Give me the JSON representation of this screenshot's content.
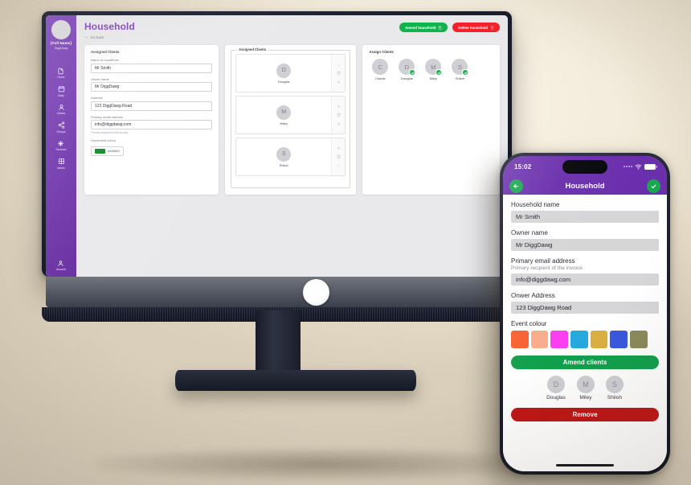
{
  "desktop": {
    "sidebar": {
      "user_name": "[Full Name]",
      "user_org": "DiggDawg",
      "items": [
        {
          "label": "Home",
          "icon": "file-icon"
        },
        {
          "label": "Diary",
          "icon": "calendar-icon"
        },
        {
          "label": "Clients",
          "icon": "person-icon"
        },
        {
          "label": "Groups",
          "icon": "share-nodes-icon"
        },
        {
          "label": "Services",
          "icon": "tools-icon"
        },
        {
          "label": "Admin",
          "icon": "grid-icon"
        }
      ],
      "account": {
        "label": "Account",
        "icon": "user-icon"
      }
    },
    "header": {
      "title": "Household",
      "go_back": "Go back",
      "amend_button": "Amend household",
      "delete_button": "Delete household"
    },
    "details_card": {
      "heading": "Assigned Clients",
      "fields": [
        {
          "label": "Name of household",
          "value": "Mr Smith"
        },
        {
          "label": "Owner name",
          "value": "Mr DiggDawg"
        },
        {
          "label": "Address",
          "value": "123 DiggDawg Road"
        },
        {
          "label": "Primary email address",
          "value": "info@diggdawg.com",
          "hint": "Primary recipient of the invoice"
        }
      ],
      "colour_label": "Household colour",
      "colour_hex": "#0A8620"
    },
    "assigned_card": {
      "legend": "Assigned Clients",
      "rows": [
        {
          "initial": "D",
          "name": "Douglas",
          "up_enabled": false,
          "down_enabled": true
        },
        {
          "initial": "M",
          "name": "Miley",
          "up_enabled": true,
          "down_enabled": true
        },
        {
          "initial": "S",
          "name": "Shiloh",
          "up_enabled": true,
          "down_enabled": false
        }
      ]
    },
    "assign_card": {
      "heading": "Assign Clients",
      "clients": [
        {
          "initial": "C",
          "name": "Charlie",
          "assigned": false
        },
        {
          "initial": "D",
          "name": "Douglas",
          "assigned": true
        },
        {
          "initial": "M",
          "name": "Miley",
          "assigned": true
        },
        {
          "initial": "S",
          "name": "Shiloh",
          "assigned": true
        }
      ]
    }
  },
  "phone": {
    "status": {
      "time": "15:02"
    },
    "app_bar": {
      "title": "Household",
      "back_icon": "arrow-left-icon",
      "confirm_icon": "check-icon"
    },
    "fields": [
      {
        "label": "Household name",
        "value": "Mr Smith"
      },
      {
        "label": "Owner name",
        "value": "Mr DiggDawg"
      },
      {
        "label": "Primary email address",
        "sub": "Primary recipient of the invoice",
        "value": "info@diggdawg.com"
      },
      {
        "label": "Onwer Address",
        "value": "123 DiggDawg Road"
      }
    ],
    "colour_label": "Event colour",
    "colours": [
      "#f96233",
      "#faac8c",
      "#fa3ef0",
      "#26a9df",
      "#dcaf42",
      "#3a58dd",
      "#8b8a5c"
    ],
    "amend_button": "Amend clients",
    "avatars": [
      {
        "initial": "D",
        "name": "Douglas"
      },
      {
        "initial": "M",
        "name": "Miley"
      },
      {
        "initial": "S",
        "name": "Shiloh"
      }
    ],
    "remove_button": "Remove"
  }
}
